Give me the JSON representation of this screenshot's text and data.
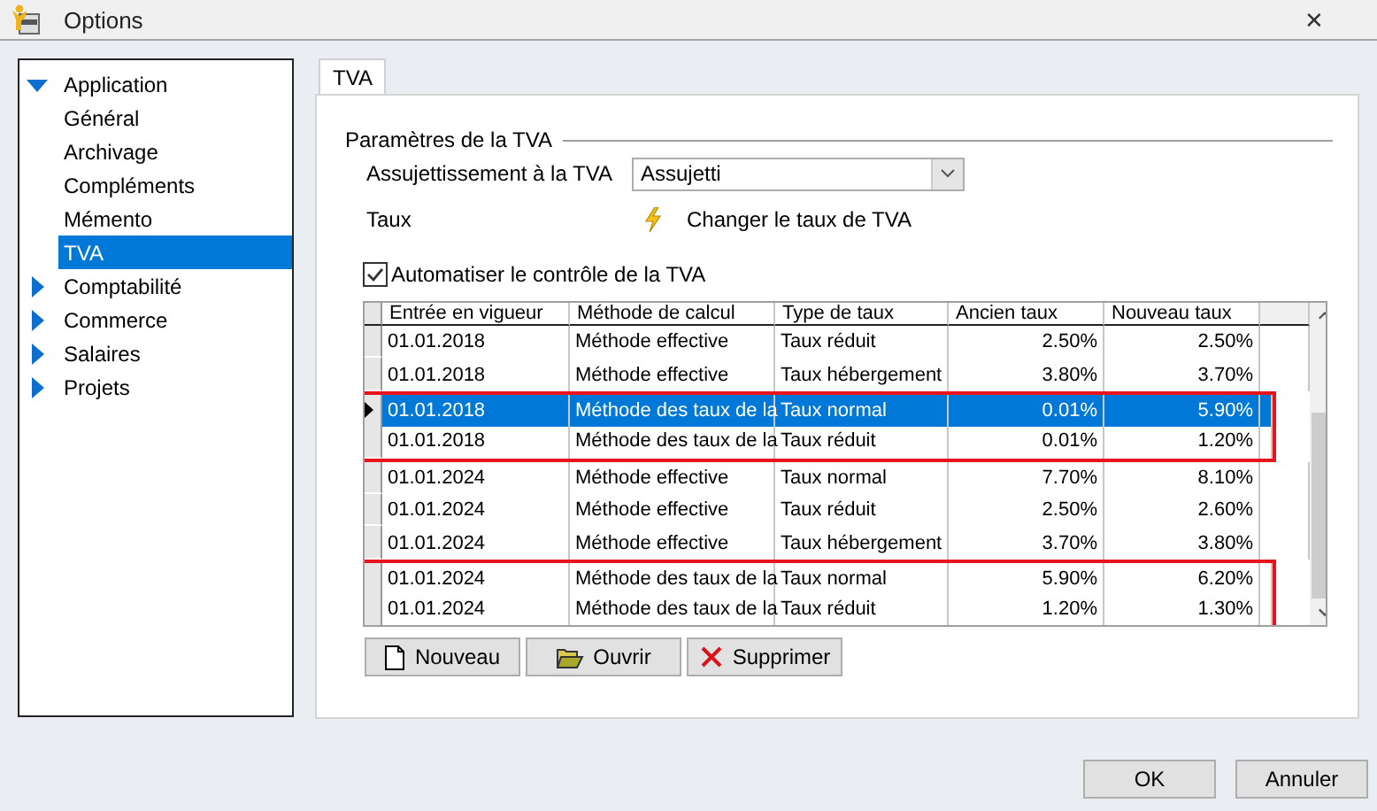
{
  "window": {
    "title": "Options",
    "close": "✕"
  },
  "sidebar": {
    "items": [
      {
        "label": "Application",
        "expanded": true,
        "selected": false,
        "children": [
          {
            "label": "Général",
            "selected": false
          },
          {
            "label": "Archivage",
            "selected": false
          },
          {
            "label": "Compléments",
            "selected": false
          },
          {
            "label": "Mémento",
            "selected": false
          },
          {
            "label": "TVA",
            "selected": true
          }
        ]
      },
      {
        "label": "Comptabilité",
        "expanded": false,
        "selected": false
      },
      {
        "label": "Commerce",
        "expanded": false,
        "selected": false
      },
      {
        "label": "Salaires",
        "expanded": false,
        "selected": false
      },
      {
        "label": "Projets",
        "expanded": false,
        "selected": false
      }
    ]
  },
  "tabs": [
    {
      "label": "TVA",
      "selected": true
    }
  ],
  "group": {
    "title": "Paramètres de la TVA",
    "subject_label": "Assujettissement à la TVA",
    "subject_value": "Assujetti",
    "rate_label": "Taux",
    "rate_link": "Changer le taux de TVA",
    "auto_check": {
      "label": "Automatiser le contrôle de la TVA",
      "checked": true
    }
  },
  "table": {
    "columns": [
      "Entrée en vigueur",
      "Méthode de calcul",
      "Type de taux",
      "Ancien taux",
      "Nouveau taux"
    ],
    "rows": [
      {
        "cells": [
          "01.01.2018",
          "Méthode effective",
          "Taux réduit",
          "2.50%",
          "2.50%"
        ],
        "selected": false,
        "highlighted": false
      },
      {
        "cells": [
          "01.01.2018",
          "Méthode effective",
          "Taux hébergement",
          "3.80%",
          "3.70%"
        ],
        "selected": false,
        "highlighted": false
      },
      {
        "cells": [
          "01.01.2018",
          "Méthode des taux de la",
          "Taux normal",
          "0.01%",
          "5.90%"
        ],
        "selected": true,
        "highlighted": true
      },
      {
        "cells": [
          "01.01.2018",
          "Méthode des taux de la",
          "Taux réduit",
          "0.01%",
          "1.20%"
        ],
        "selected": false,
        "highlighted": true
      },
      {
        "cells": [
          "01.01.2024",
          "Méthode effective",
          "Taux normal",
          "7.70%",
          "8.10%"
        ],
        "selected": false,
        "highlighted": false
      },
      {
        "cells": [
          "01.01.2024",
          "Méthode effective",
          "Taux réduit",
          "2.50%",
          "2.60%"
        ],
        "selected": false,
        "highlighted": false
      },
      {
        "cells": [
          "01.01.2024",
          "Méthode effective",
          "Taux hébergement",
          "3.70%",
          "3.80%"
        ],
        "selected": false,
        "highlighted": false
      },
      {
        "cells": [
          "01.01.2024",
          "Méthode des taux de la",
          "Taux normal",
          "5.90%",
          "6.20%"
        ],
        "selected": false,
        "highlighted": true
      },
      {
        "cells": [
          "01.01.2024",
          "Méthode des taux de la",
          "Taux réduit",
          "1.20%",
          "1.30%"
        ],
        "selected": false,
        "highlighted": true
      }
    ]
  },
  "table_buttons": [
    {
      "kind": "new",
      "label": "Nouveau"
    },
    {
      "kind": "open",
      "label": "Ouvrir"
    },
    {
      "kind": "delete",
      "label": "Supprimer"
    }
  ],
  "buttons": [
    "OK",
    "Annuler"
  ]
}
